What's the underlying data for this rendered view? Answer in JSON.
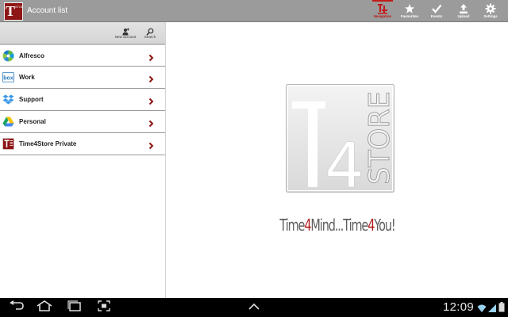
{
  "app": {
    "logo_letter": "T",
    "logo_small": "STORE",
    "title": "Account list"
  },
  "actions": [
    {
      "label": "Navigation",
      "icon": "navigation-icon",
      "selected": true
    },
    {
      "label": "Favourites",
      "icon": "star-icon",
      "selected": false
    },
    {
      "label": "Events",
      "icon": "checkmark-icon",
      "selected": false
    },
    {
      "label": "Upload",
      "icon": "upload-icon",
      "selected": false
    },
    {
      "label": "Settings",
      "icon": "gear-icon",
      "selected": false
    }
  ],
  "toolbar": {
    "new_account_label": "New account",
    "search_label": "Search"
  },
  "accounts": [
    {
      "name": "Alfresco",
      "icon": "alfresco-icon"
    },
    {
      "name": "Work",
      "icon": "box-icon"
    },
    {
      "name": "Support",
      "icon": "dropbox-icon"
    },
    {
      "name": "Personal",
      "icon": "google-drive-icon"
    },
    {
      "name": "Time4Store Private",
      "icon": "time4store-icon"
    }
  ],
  "brand": {
    "letter_t": "T",
    "digit": "4",
    "word": "STORE",
    "tagline_a": "Time",
    "tagline_b": "4",
    "tagline_c": "Mind...Time",
    "tagline_d": "4",
    "tagline_e": "You!"
  },
  "system": {
    "clock": "12:09"
  },
  "colors": {
    "accent": "#b11a1a",
    "actionbar": "#9b9b9b",
    "logo_bg": "#8e1515"
  }
}
